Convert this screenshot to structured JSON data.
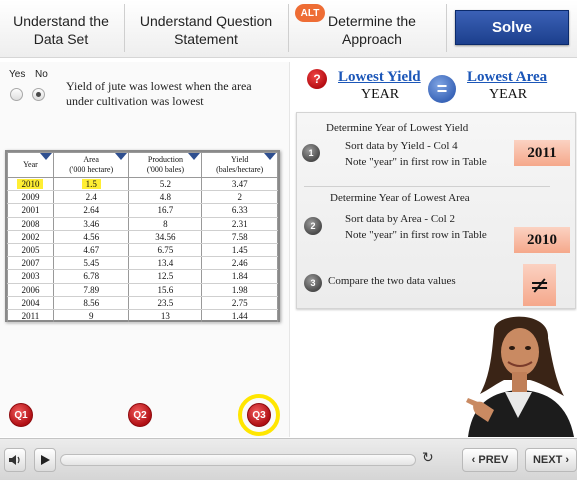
{
  "tabs": [
    {
      "label": "Understand the Data Set"
    },
    {
      "label": "Understand Question Statement"
    },
    {
      "label": "Determine the Approach",
      "badge": "ALT"
    }
  ],
  "solve_label": "Solve",
  "choice": {
    "yes_label": "Yes",
    "no_label": "No",
    "selected": "No",
    "statement": "Yield of jute was lowest when the area under cultivation was lowest"
  },
  "table": {
    "headers": [
      {
        "line1": "Year",
        "line2": ""
      },
      {
        "line1": "Area",
        "line2": "('000 hectare)"
      },
      {
        "line1": "Production",
        "line2": "('000 bales)"
      },
      {
        "line1": "Yield",
        "line2": "(bales/hectare)"
      }
    ],
    "rows": [
      [
        "2010",
        "1.5",
        "5.2",
        "3.47"
      ],
      [
        "2009",
        "2.4",
        "4.8",
        "2"
      ],
      [
        "2001",
        "2.64",
        "16.7",
        "6.33"
      ],
      [
        "2008",
        "3.46",
        "8",
        "2.31"
      ],
      [
        "2002",
        "4.56",
        "34.56",
        "7.58"
      ],
      [
        "2005",
        "4.67",
        "6.75",
        "1.45"
      ],
      [
        "2007",
        "5.45",
        "13.4",
        "2.46"
      ],
      [
        "2003",
        "6.78",
        "12.5",
        "1.84"
      ],
      [
        "2006",
        "7.89",
        "15.6",
        "1.98"
      ],
      [
        "2004",
        "8.56",
        "23.5",
        "2.75"
      ],
      [
        "2011",
        "9",
        "13",
        "1.44"
      ]
    ],
    "highlight_color": "#ffee33"
  },
  "question_buttons": [
    "Q1",
    "Q2",
    "Q3"
  ],
  "active_question": "Q3",
  "approach": {
    "question_icon": "?",
    "equals_icon": "=",
    "left_link": "Lowest Yield",
    "left_sub": "YEAR",
    "right_link": "Lowest Area",
    "right_sub": "YEAR",
    "step1_title": "Determine Year of Lowest Yield",
    "step1_line1": "Sort data by Yield - Col 4",
    "step1_line2": "Note \"year\" in first row in Table",
    "step1_answer": "2011",
    "step2_title": "Determine Year of Lowest Area",
    "step2_line1": "Sort data by Area - Col 2",
    "step2_line2": "Note \"year\" in first row in Table",
    "step2_answer": "2010",
    "step3_text": "Compare the two data values",
    "step3_answer": "≠",
    "step_numbers": [
      "1",
      "2",
      "3"
    ]
  },
  "player": {
    "prev_label": "‹ PREV",
    "next_label": "NEXT ›",
    "progress": 0.0
  },
  "colors": {
    "accent_blue": "#1c3f8d",
    "link_blue": "#1b56b8",
    "question_red": "#b00f14",
    "answer_peach": "#f5a88b",
    "ring_yellow": "#ffe600"
  }
}
